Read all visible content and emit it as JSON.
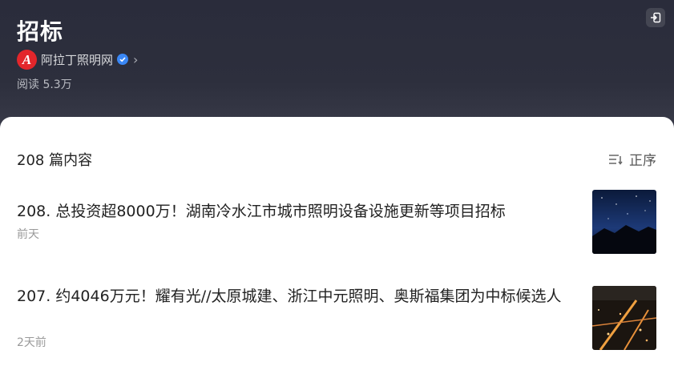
{
  "header": {
    "title": "招标",
    "author": {
      "name": "阿拉丁照明网",
      "logo_letter": "A",
      "verified": true
    },
    "reads": "阅读 5.3万"
  },
  "list": {
    "count_label": "208 篇内容",
    "sort_label": "正序",
    "items": [
      {
        "title": "208. 总投资超8000万！湖南冷水江市城市照明设备设施更新等项目招标",
        "time": "前天"
      },
      {
        "title": "207. 约4046万元！耀有光//太原城建、浙江中元照明、奥斯福集团为中标候选人",
        "time": "2天前"
      }
    ]
  },
  "colors": {
    "header_bg": "#2d2f3d",
    "logo_red": "#e3262b",
    "verified_blue": "#3a87f5"
  },
  "icons": [
    "exit-icon",
    "verified-icon",
    "chevron-right-icon",
    "sort-icon"
  ]
}
